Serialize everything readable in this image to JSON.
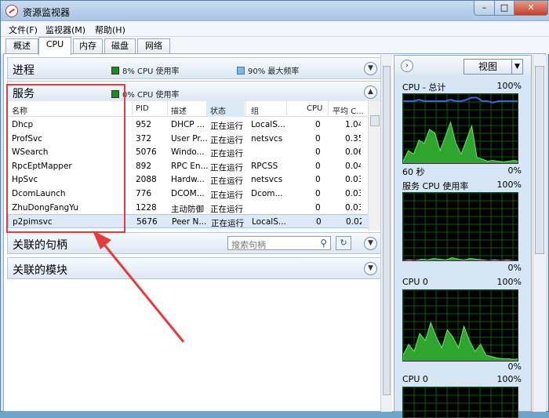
{
  "window": {
    "title": "资源监视器"
  },
  "menu": [
    "文件(F)",
    "监视器(M)",
    "帮助(H)"
  ],
  "tabs": [
    "概述",
    "CPU",
    "内存",
    "磁盘",
    "网络"
  ],
  "active_tab": "CPU",
  "sections": {
    "process": {
      "title": "进程",
      "cpu_usage": "8% CPU 使用率",
      "max_freq": "90% 最大频率"
    },
    "services": {
      "title": "服务",
      "cpu_usage": "0% CPU 使用率"
    },
    "handles": {
      "title": "关联的句柄",
      "search_placeholder": "搜索句柄"
    },
    "modules": {
      "title": "关联的模块"
    }
  },
  "services_table": {
    "columns": [
      "名称",
      "PID",
      "描述",
      "状态",
      "组",
      "CPU",
      "平均 C..."
    ],
    "rows": [
      [
        "Dhcp",
        "952",
        "DHCP ...",
        "正在运行",
        "LocalS...",
        "0",
        "1.04"
      ],
      [
        "ProfSvc",
        "372",
        "User Pr...",
        "正在运行",
        "netsvcs",
        "0",
        "0.35"
      ],
      [
        "WSearch",
        "5076",
        "Windo...",
        "正在运行",
        "",
        "0",
        "0.06"
      ],
      [
        "RpcEptMapper",
        "892",
        "RPC En...",
        "正在运行",
        "RPCSS",
        "0",
        "0.04"
      ],
      [
        "HpSvc",
        "2088",
        "Hardw...",
        "正在运行",
        "netsvcs",
        "0",
        "0.03"
      ],
      [
        "DcomLaunch",
        "776",
        "DCOM...",
        "正在运行",
        "Dcom...",
        "0",
        "0.03"
      ],
      [
        "ZhuDongFangYu",
        "1228",
        "主动防御",
        "正在运行",
        "",
        "0",
        "0.03"
      ],
      [
        "p2pimsvc",
        "5676",
        "Peer N...",
        "正在运行",
        "LocalS...",
        "0",
        "0.02"
      ]
    ]
  },
  "right_panel": {
    "view_label": "视图",
    "graphs": [
      {
        "title": "CPU - 总计",
        "max": "100%",
        "footer_left": "60 秒",
        "footer_right": "0%"
      },
      {
        "title": "服务 CPU 使用率",
        "max": "100%",
        "footer_right": "0%"
      },
      {
        "title": "CPU 0",
        "max": "100%",
        "footer_right": "0%"
      },
      {
        "title": "CPU 0",
        "max": "100%"
      }
    ]
  },
  "colors": {
    "graph_fill": "#2fa52f",
    "graph_line": "#6ee36e",
    "max_freq_line": "#3f66d9",
    "annotation": "#e53b3b"
  }
}
